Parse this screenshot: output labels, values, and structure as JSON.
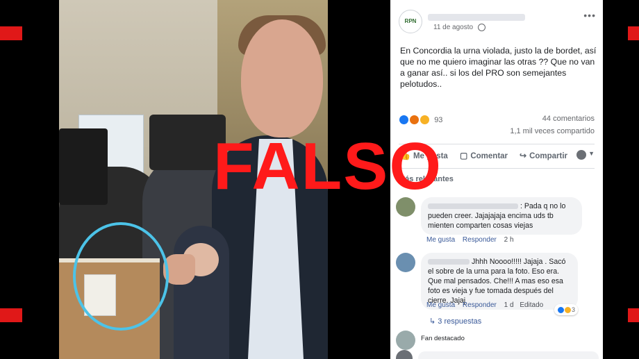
{
  "overlay": {
    "verdict": "FALSO",
    "color": "#ff1a1a",
    "frame_marker_color": "#e01818",
    "circle_color": "#4cc3e8"
  },
  "post": {
    "page_logo_text": "RPN",
    "date": "11 de agosto",
    "more_icon": "more-icon",
    "text": "En Concordia la urna violada, justo la de bordet, así que no me quiero imaginar las otras ?? Que no van a ganar así.. si los del PRO son semejantes pelotudos..",
    "reaction_count": "93",
    "comments_count": "44 comentarios",
    "shares_count": "1,1 mil veces compartido"
  },
  "actions": {
    "like": "Me gusta",
    "comment": "Comentar",
    "share": "Compartir"
  },
  "sort_label": "Más relevantes",
  "comments": [
    {
      "text": ": Pada q no lo pueden creer. Jajajajaja encima uds tb mienten comparten cosas viejas",
      "like": "Me gusta",
      "reply": "Responder",
      "time": "2 h"
    },
    {
      "text": "Jhhh Noooo!!!!! Jajaja . Sacó el sobre de la urna para la foto. Eso era. Que mal pensados. Che!!! A mas eso esa foto es vieja y fue tomada después del cierre. Jajaj",
      "like": "Me gusta",
      "reply": "Responder",
      "time": "1 d",
      "edited": "Editado",
      "reactions": "3"
    }
  ],
  "replies_label": "3 respuestas",
  "fan_label": "Fan destacado"
}
